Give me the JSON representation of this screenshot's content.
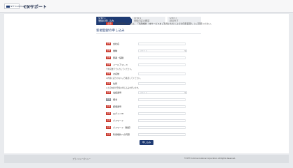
{
  "header": {
    "logo_text": "NTT Communications",
    "brand": "CXサポート"
  },
  "steps": [
    {
      "num": "STEP 1",
      "label": "登録の申し込み"
    },
    {
      "num": "STEP 2",
      "label": "登録内容の確認"
    },
    {
      "num": "STEP 3",
      "label": "送信完了"
    }
  ],
  "page_title": "新規登録の申し込み",
  "notice": {
    "tag": "必須",
    "text": "必須項目を入力の上、「利用規約（本サービスをご利用いただく上での同意事項）」にご同意ください。"
  },
  "rows": [
    {
      "badge": "必須",
      "label": "会社名",
      "placeholder": "",
      "kind": "input"
    },
    {
      "badge": "必須",
      "label": "業種",
      "placeholder": "選択する",
      "kind": "select"
    },
    {
      "badge": "必須",
      "label": "部署・役職",
      "placeholder": "",
      "kind": "input"
    },
    {
      "badge": "必須",
      "label": "メールアドレス",
      "placeholder": "",
      "kind": "input"
    },
    {
      "badge": "必須",
      "label": "お名前",
      "placeholder": "",
      "kind": "input"
    },
    {
      "badge": "必須",
      "label": "住所",
      "placeholder": "",
      "kind": "input"
    },
    {
      "badge": "必須",
      "label": "電話番号",
      "placeholder": "選択する",
      "kind": "select"
    },
    {
      "badge": "任意",
      "label": "備考",
      "placeholder": "",
      "kind": "input"
    },
    {
      "badge": "必須",
      "label": "郵便番号",
      "placeholder": "",
      "kind": "input"
    },
    {
      "badge": "必須",
      "label": "ログインID",
      "placeholder": "",
      "kind": "input"
    },
    {
      "badge": "必須",
      "label": "パスワード",
      "placeholder": "",
      "kind": "input"
    },
    {
      "badge": "必須",
      "label": "パスワード（確認）",
      "placeholder": "",
      "kind": "input"
    },
    {
      "badge": "必須",
      "label": "利用規約への同意",
      "placeholder": "",
      "kind": "input"
    }
  ],
  "helps": [
    "半角英数字で入力してください。",
    "※内容に誤りのないよう確認してください。",
    "※上記内容で登録の申し込みを行います。"
  ],
  "submit_label": "申し込み",
  "footer": {
    "links": "プライバシーポリシー",
    "copyright": "© NTT Communications Corporation All Rights Reserved."
  }
}
